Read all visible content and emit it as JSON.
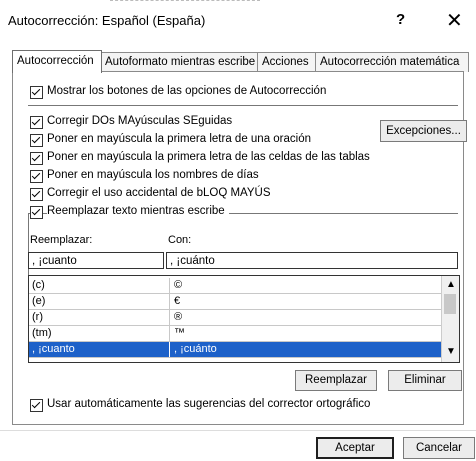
{
  "window": {
    "title": "Autocorrección: Español (España)",
    "help": "?",
    "close": "✕"
  },
  "tabs": [
    {
      "label": "Autocorrección"
    },
    {
      "label": "Autoformato mientras escribe"
    },
    {
      "label": "Acciones"
    },
    {
      "label": "Autocorrección matemática"
    }
  ],
  "options": {
    "show_buttons": "Mostrar los botones de las opciones de Autocorrección",
    "two_initials": "Corregir DOs MAyúsculas SEguidas",
    "sentence_caps": "Poner en mayúscula la primera letra de una oración",
    "table_caps": "Poner en mayúscula la primera letra de las celdas de las tablas",
    "day_names": "Poner en mayúscula los nombres de días",
    "caps_lock": "Corregir el uso accidental de bLOQ MAYÚS",
    "replace_typing": "Reemplazar texto mientras escribe"
  },
  "exceptions_button": "Excepciones...",
  "replace": {
    "label_replace": "Reemplazar:",
    "label_with": "Con:",
    "replace_value": ", ¡cuanto",
    "with_value": ", ¡cuánto"
  },
  "list": [
    {
      "from": "(c)",
      "to": "©"
    },
    {
      "from": "(e)",
      "to": "€"
    },
    {
      "from": "(r)",
      "to": "®"
    },
    {
      "from": "(tm)",
      "to": "™"
    },
    {
      "from": ", ¡cuanto",
      "to": ", ¡cuánto"
    }
  ],
  "buttons": {
    "replace": "Reemplazar",
    "delete": "Eliminar",
    "ok": "Aceptar",
    "cancel": "Cancelar"
  },
  "spell_suggestions": "Usar automáticamente las sugerencias del corrector ortográfico",
  "scroll": {
    "up": "▲",
    "down": "▼"
  },
  "colors": {
    "selection": "#1d61c9"
  }
}
